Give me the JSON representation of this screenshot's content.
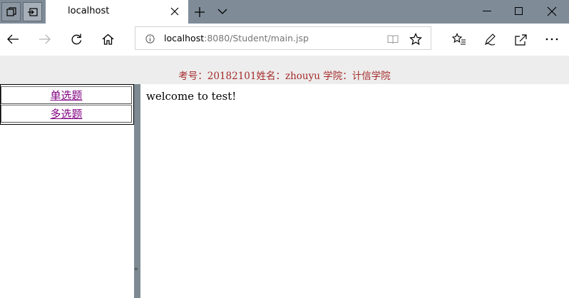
{
  "browser": {
    "tab": {
      "title": "localhost"
    },
    "address": {
      "host": "localhost",
      "rest": ":8080/Student/main.jsp"
    },
    "colors": {
      "tabstrip": "#7f8c98",
      "splitter": "#7d8a92",
      "header_bg": "#ededed",
      "header_text": "#a52a2a",
      "link_visited": "#800080"
    },
    "icons": [
      "tab-preview-icon",
      "set-aside-tabs-icon",
      "close-icon",
      "new-tab-icon",
      "chevron-down-icon",
      "minimize-icon",
      "maximize-icon",
      "close-window-icon",
      "back-icon",
      "forward-icon",
      "refresh-icon",
      "home-icon",
      "info-icon",
      "reading-view-icon",
      "star-icon",
      "favorites-icon",
      "pen-icon",
      "share-icon",
      "more-icon"
    ]
  },
  "page": {
    "header": "考号：20182101姓名：zhouyu 学院：计信学院",
    "menu": [
      {
        "label": "单选题"
      },
      {
        "label": "多选题"
      }
    ],
    "splitter_arrow": "«",
    "main": {
      "welcome": "welcome to test!"
    }
  }
}
